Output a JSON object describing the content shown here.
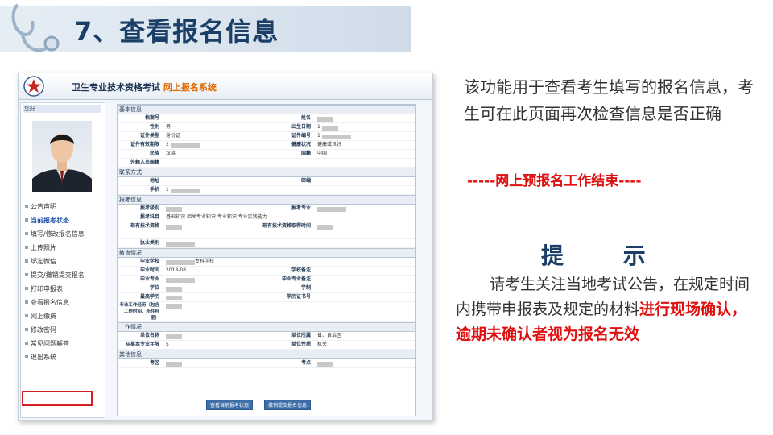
{
  "slide": {
    "title": "7、查看报名信息",
    "description": "该功能用于查看考生填写的报名信息，考生可在此页面再次检查信息是否正确",
    "end_notice": "-----网上预报名工作结束----",
    "tip_title": "提 示",
    "tip_text_normal": "请考生关注当地考试公告，在规定时间内携带申报表及规定的材料",
    "tip_text_red": "进行现场确认，逾期未确认者视为报名无效"
  },
  "screenshot": {
    "sys_title_main": "卫生专业技术资格考试",
    "sys_title_highlight": "网上报名系统",
    "greeting": "您好",
    "menu": [
      {
        "label": "公告声明"
      },
      {
        "label": "当前报考状态"
      },
      {
        "label": "填写/修改报名信息"
      },
      {
        "label": "上传照片"
      },
      {
        "label": "绑定微信"
      },
      {
        "label": "提交/撤销提交报名"
      },
      {
        "label": "打印申报表"
      },
      {
        "label": "查看报名信息"
      },
      {
        "label": "网上缴费"
      },
      {
        "label": "修改密码"
      },
      {
        "label": "常见问题解答"
      },
      {
        "label": "退出系统"
      }
    ],
    "sections": {
      "basic": "基本信息",
      "contact": "联系方式",
      "apply": "报考信息",
      "edu": "教育情况",
      "work": "工作情况",
      "other": "其他信息"
    },
    "basic": {
      "archive_label": "档案号",
      "name_label": "姓名",
      "gender_label": "性别",
      "gender_value": "男",
      "birth_label": "出生日期",
      "birth_value": "1",
      "idtype_label": "证件类型",
      "idtype_value": "身份证",
      "idno_label": "证件编号",
      "idno_value": "1",
      "idvalid_label": "证件有效期限",
      "idvalid_value": "2",
      "health_label": "健康状况",
      "health_value": "健康或良好",
      "nation_label": "民族",
      "nation_value": "汉族",
      "country_label": "国籍",
      "country_value": "中国",
      "foreign_label": "外籍人员国籍"
    },
    "contact": {
      "address_label": "地址",
      "post_label": "邮编",
      "phone_label": "手机",
      "phone_value": "1"
    },
    "apply": {
      "level_label": "报考级别",
      "major_label": "报考专业",
      "subject_label": "报考科目",
      "subject_value": "基础知识 相关专业知识 专业知识 专业实践能力",
      "cur_title_label": "现有技术资格",
      "cur_title_time_label": "现有技术资格取得时间",
      "practice_label": "执业类别"
    },
    "edu": {
      "school_label": "毕业学校",
      "school_value": "专科学校",
      "gradtime_label": "毕业时间",
      "gradtime_value": "2018-08",
      "schoolnote_label": "学校备注",
      "gradmajor_label": "毕业专业",
      "gradmajornote_label": "毕业专业备注",
      "degree_label": "学位",
      "discipline_label": "学制",
      "highest_label": "最高学历",
      "certno_label": "学历证书号",
      "resume_label": "专业工作经历（包含工作时间、所在科室）"
    },
    "work": {
      "unit_label": "单位名称",
      "region_label": "单位所属",
      "region_value": "省、自治区",
      "years_label": "从事本专业年限",
      "years_value": "5",
      "nature_label": "单位性质",
      "nature_value": "机关"
    },
    "other": {
      "exam_area_label": "考区",
      "exam_point_label": "考点"
    },
    "buttons": {
      "view_status": "查看当前报考状态",
      "revoke": "撤销提交报名信息"
    }
  }
}
